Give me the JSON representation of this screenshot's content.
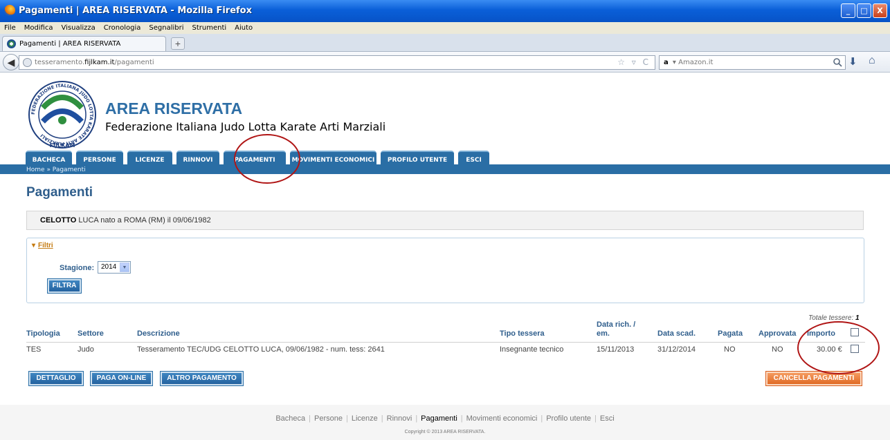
{
  "window": {
    "title": "Pagamenti | AREA RISERVATA - Mozilla Firefox",
    "buttons": [
      "_",
      "□",
      "X"
    ]
  },
  "menubar": {
    "items": [
      "File",
      "Modifica",
      "Visualizza",
      "Cronologia",
      "Segnalibri",
      "Strumenti",
      "Aiuto"
    ]
  },
  "tab": {
    "label": "Pagamenti | AREA RISERVATA",
    "new_tab_label": "+"
  },
  "navbar": {
    "url_prefix": "tesseramento.",
    "url_domain": "fijlkam.it",
    "url_path": "/pagamenti",
    "url_tools": "☆ ▿ C",
    "search_engine": "a",
    "search_placeholder": " ▾ Amazon.it"
  },
  "site": {
    "logo_text": "FEDERAZIONE ITALIANA JUDO LOTTA KARATE ARTI MARZIALI",
    "logo_wordmark": "FIJLKAM",
    "title": "AREA RISERVATA",
    "subtitle": "Federazione Italiana Judo Lotta Karate Arti Marziali"
  },
  "nav_tabs": [
    "BACHECA",
    "PERSONE",
    "LICENZE",
    "RINNOVI",
    "PAGAMENTI",
    "MOVIMENTI ECONOMICI",
    "PROFILO UTENTE",
    "ESCI"
  ],
  "breadcrumb": "Home » Pagamenti",
  "page_heading": "Pagamenti",
  "athlete": {
    "surname": "CELOTTO",
    "rest": " LUCA nato a ROMA (RM) il 09/06/1982"
  },
  "filters": {
    "title": "Filtri",
    "arrow": "▾",
    "stagione_label": "Stagione:",
    "stagione_value": "2014",
    "filtra_button": "FILTRA"
  },
  "totale": {
    "label": "Totale tessere: ",
    "value": "1"
  },
  "table": {
    "headers": {
      "tipologia": "Tipologia",
      "settore": "Settore",
      "descrizione": "Descrizione",
      "tipo_tessera": "Tipo tessera",
      "data_rich_1": "Data rich. /",
      "data_rich_2": "em.",
      "data_scad": "Data scad.",
      "pagata": "Pagata",
      "approvata": "Approvata",
      "importo": "Importo"
    },
    "row": {
      "tipologia": "TES",
      "settore": "Judo",
      "descrizione": "Tesseramento TEC/UDG CELOTTO LUCA, 09/06/1982 - num. tess: 2641",
      "tipo_tessera": "Insegnante tecnico",
      "data_rich": "15/11/2013",
      "data_scad": "31/12/2014",
      "pagata": "NO",
      "approvata": "NO",
      "importo": "30.00 €"
    }
  },
  "actions": {
    "dettaglio": "DETTAGLIO",
    "paga_online": "PAGA ON-LINE",
    "altro_pagamento": "ALTRO PAGAMENTO",
    "cancella": "CANCELLA PAGAMENTI"
  },
  "footer": {
    "links": [
      "Bacheca",
      "Persone",
      "Licenze",
      "Rinnovi",
      "Pagamenti",
      "Movimenti economici",
      "Profilo utente",
      "Esci"
    ],
    "copyright": "Copyright © 2013 AREA RISERVATA."
  },
  "colors": {
    "brand_blue": "#2a6ea5",
    "heading_blue": "#2f5e8c",
    "orange": "#e06a25",
    "annotation_red": "#b01515"
  }
}
